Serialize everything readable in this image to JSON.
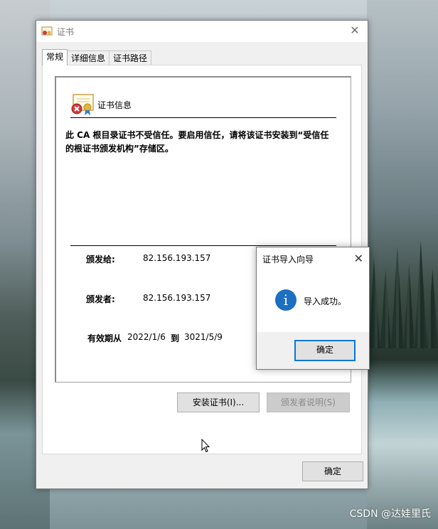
{
  "window": {
    "title": "证书",
    "close_label": "✕"
  },
  "tabs": [
    {
      "label": "常规",
      "active": true
    },
    {
      "label": "详细信息",
      "active": false
    },
    {
      "label": "证书路径",
      "active": false
    }
  ],
  "cert_info": {
    "heading": "证书信息",
    "warning": "此 CA 根目录证书不受信任。要启用信任，请将该证书安装到“受信任的根证书颁发机构”存储区。",
    "issued_to_label": "颁发给:",
    "issued_to_value": "82.156.193.157",
    "issued_by_label": "颁发者:",
    "issued_by_value": "82.156.193.157",
    "validity_label": "有效期从",
    "valid_from": "2022/1/6",
    "to_label": "到",
    "valid_to": "3021/5/9"
  },
  "buttons": {
    "install": "安装证书(I)...",
    "issuer_statement": "颁发者说明(S)",
    "ok": "确定"
  },
  "wizard": {
    "title": "证书导入向导",
    "message": "导入成功。",
    "ok": "确定",
    "close_label": "✕"
  },
  "watermark": "CSDN @达娃里氏",
  "colors": {
    "accent": "#0078d7",
    "info_icon": "#1d6fc1"
  }
}
